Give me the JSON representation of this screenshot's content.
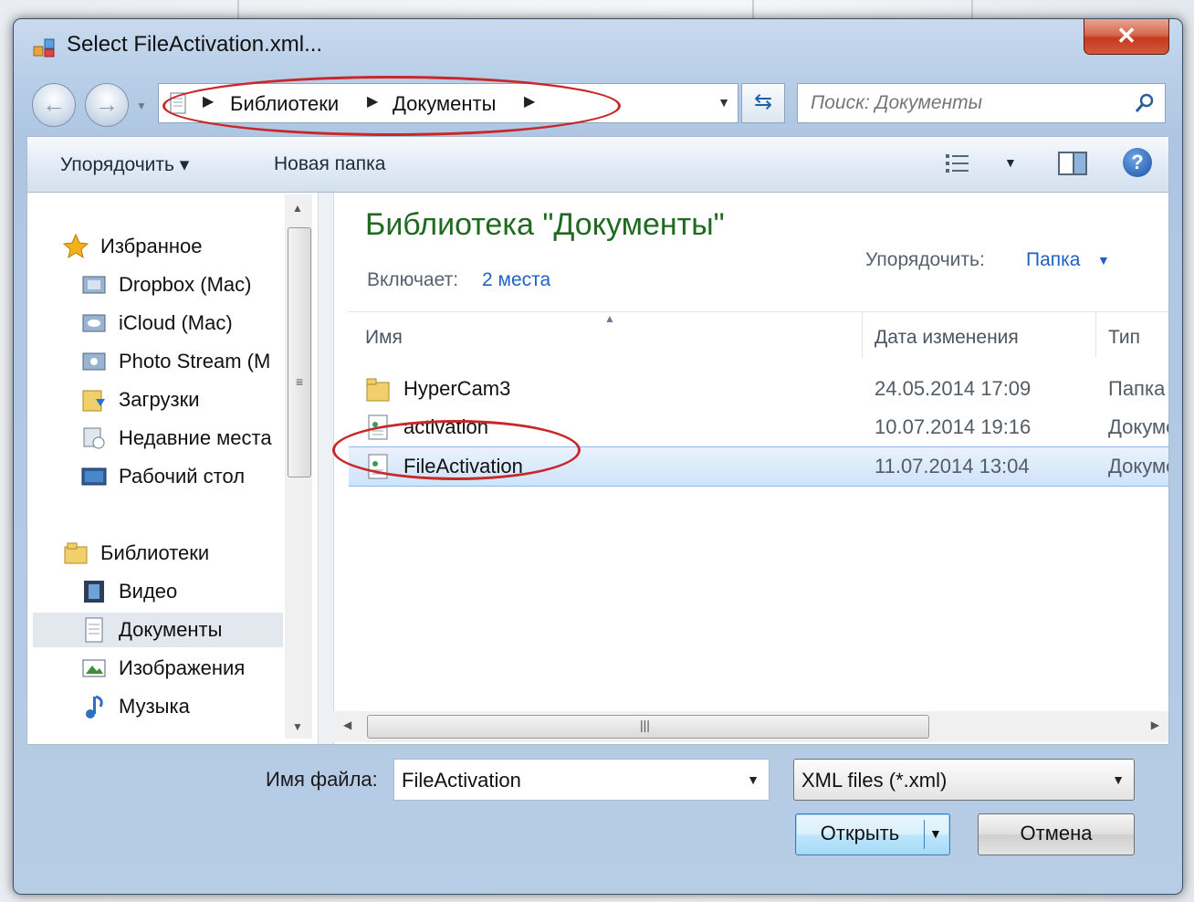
{
  "window": {
    "title": "Select FileActivation.xml...",
    "close_label": "✕"
  },
  "address": {
    "crumbs": [
      "Библиотеки",
      "Документы"
    ],
    "recent_icon": "chevron-down-icon"
  },
  "search": {
    "placeholder": "Поиск: Документы"
  },
  "toolbar": {
    "organize_label": "Упорядочить ▾",
    "new_folder_label": "Новая папка"
  },
  "nav": {
    "favorites_label": "Избранное",
    "favorites": [
      "Dropbox (Mac)",
      "iCloud (Mac)",
      "Photo Stream (M",
      "Загрузки",
      "Недавние места",
      "Рабочий стол"
    ],
    "libraries_label": "Библиотеки",
    "libraries": [
      "Видео",
      "Документы",
      "Изображения",
      "Музыка"
    ]
  },
  "library": {
    "title": "Библиотека \"Документы\"",
    "includes_label": "Включает:",
    "includes_link": "2 места",
    "arrange_label": "Упорядочить:",
    "arrange_value": "Папка"
  },
  "columns": {
    "name": "Имя",
    "date": "Дата изменения",
    "type": "Тип"
  },
  "files": [
    {
      "name": "HyperCam3",
      "date": "24.05.2014 17:09",
      "type": "Папка с",
      "icon": "folder-icon"
    },
    {
      "name": "activation",
      "date": "10.07.2014 19:16",
      "type": "Докуме",
      "icon": "xml-file-icon"
    },
    {
      "name": "FileActivation",
      "date": "11.07.2014 13:04",
      "type": "Докуме",
      "icon": "xml-file-icon",
      "selected": true
    }
  ],
  "footer": {
    "filename_label": "Имя файла:",
    "filename_value": "FileActivation",
    "filetype_value": "XML files (*.xml)",
    "open_label": "Открыть",
    "cancel_label": "Отмена"
  },
  "colors": {
    "annotation": "#c8282a",
    "library_title": "#1e6a1e",
    "link": "#1d63c4"
  }
}
